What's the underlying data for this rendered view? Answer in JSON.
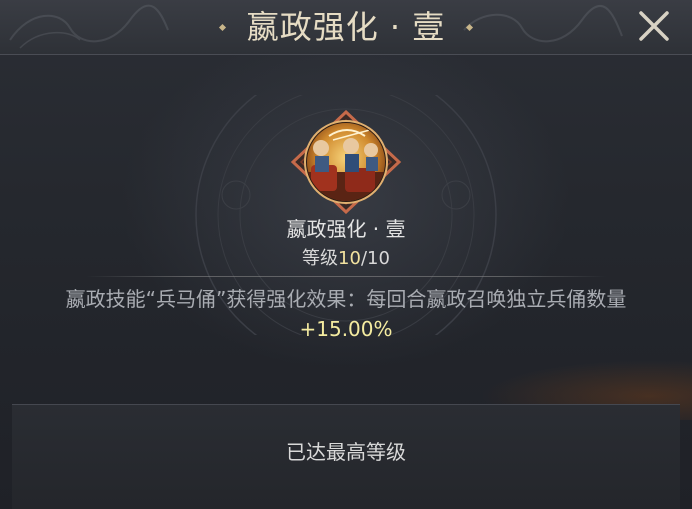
{
  "dialog": {
    "title": "嬴政强化 · 壹",
    "close_icon": "close-icon"
  },
  "skill": {
    "icon": "archer-warriors-icon",
    "name": "嬴政强化 · 壹",
    "level_prefix": "等级",
    "level_current": "10",
    "level_separator": "/",
    "level_max": "10",
    "level_progress": 1.0
  },
  "description": {
    "text": "嬴政技能“兵马俑”获得强化效果：每回合嬴政召唤独立兵俑数量",
    "value": "+15.00%"
  },
  "footer": {
    "status": "已达最高等级"
  },
  "colors": {
    "title": "#e6dcc4",
    "highlight": "#f4eba0",
    "frame": "#c66a4a",
    "background": "#25282e"
  }
}
